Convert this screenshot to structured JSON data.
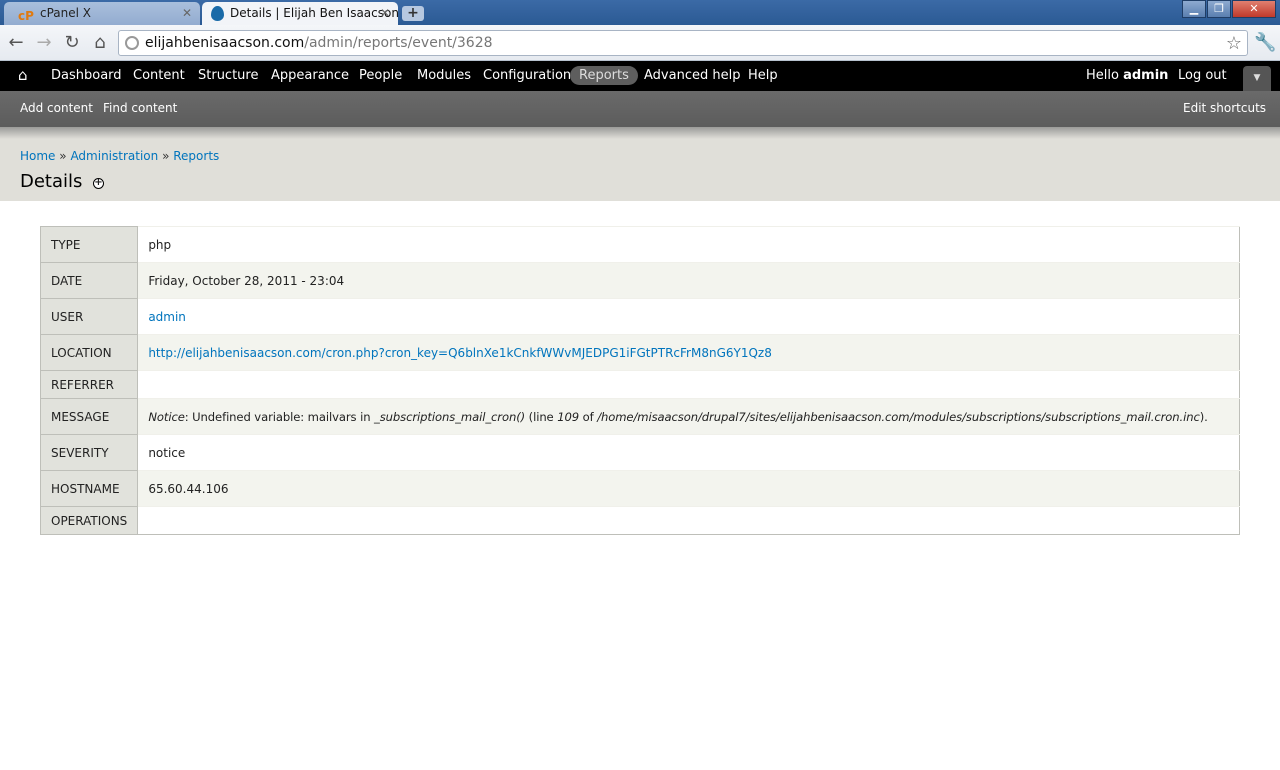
{
  "browser": {
    "tabs": [
      {
        "label": "cPanel X",
        "icon": "cpanel-icon",
        "active": false
      },
      {
        "label": "Details | Elijah Ben Isaacson",
        "icon": "drupal-icon",
        "active": true
      }
    ],
    "url_host": "elijahbenisaacson.com",
    "url_path": "/admin/reports/event/3628"
  },
  "admin_menu": {
    "items": [
      "Dashboard",
      "Content",
      "Structure",
      "Appearance",
      "People",
      "Modules",
      "Configuration",
      "Reports",
      "Advanced help",
      "Help"
    ],
    "active": "Reports",
    "hello_prefix": "Hello",
    "user": "admin",
    "logout": "Log out"
  },
  "shortcuts": {
    "items": [
      "Add content",
      "Find content"
    ],
    "edit": "Edit shortcuts"
  },
  "breadcrumb": {
    "items": [
      "Home",
      "Administration",
      "Reports"
    ],
    "separator": "»"
  },
  "page": {
    "title": "Details"
  },
  "details": {
    "type_label": "TYPE",
    "type": "php",
    "date_label": "DATE",
    "date": "Friday, October 28, 2011 - 23:04",
    "user_label": "USER",
    "user": "admin",
    "location_label": "LOCATION",
    "location": "http://elijahbenisaacson.com/cron.php?cron_key=Q6blnXe1kCnkfWWvMJEDPG1iFGtPTRcFrM8nG6Y1Qz8",
    "referrer_label": "REFERRER",
    "referrer": "",
    "message_label": "MESSAGE",
    "message": {
      "level": "Notice",
      "text1": ": Undefined variable: mailvars in ",
      "function": "_subscriptions_mail_cron()",
      "text2": " (line ",
      "line": "109",
      "text3": " of ",
      "file": "/home/misaacson/drupal7/sites/elijahbenisaacson.com/modules/subscriptions/subscriptions_mail.cron.inc",
      "text4": ")."
    },
    "severity_label": "SEVERITY",
    "severity": "notice",
    "hostname_label": "HOSTNAME",
    "hostname": "65.60.44.106",
    "operations_label": "OPERATIONS",
    "operations": ""
  }
}
